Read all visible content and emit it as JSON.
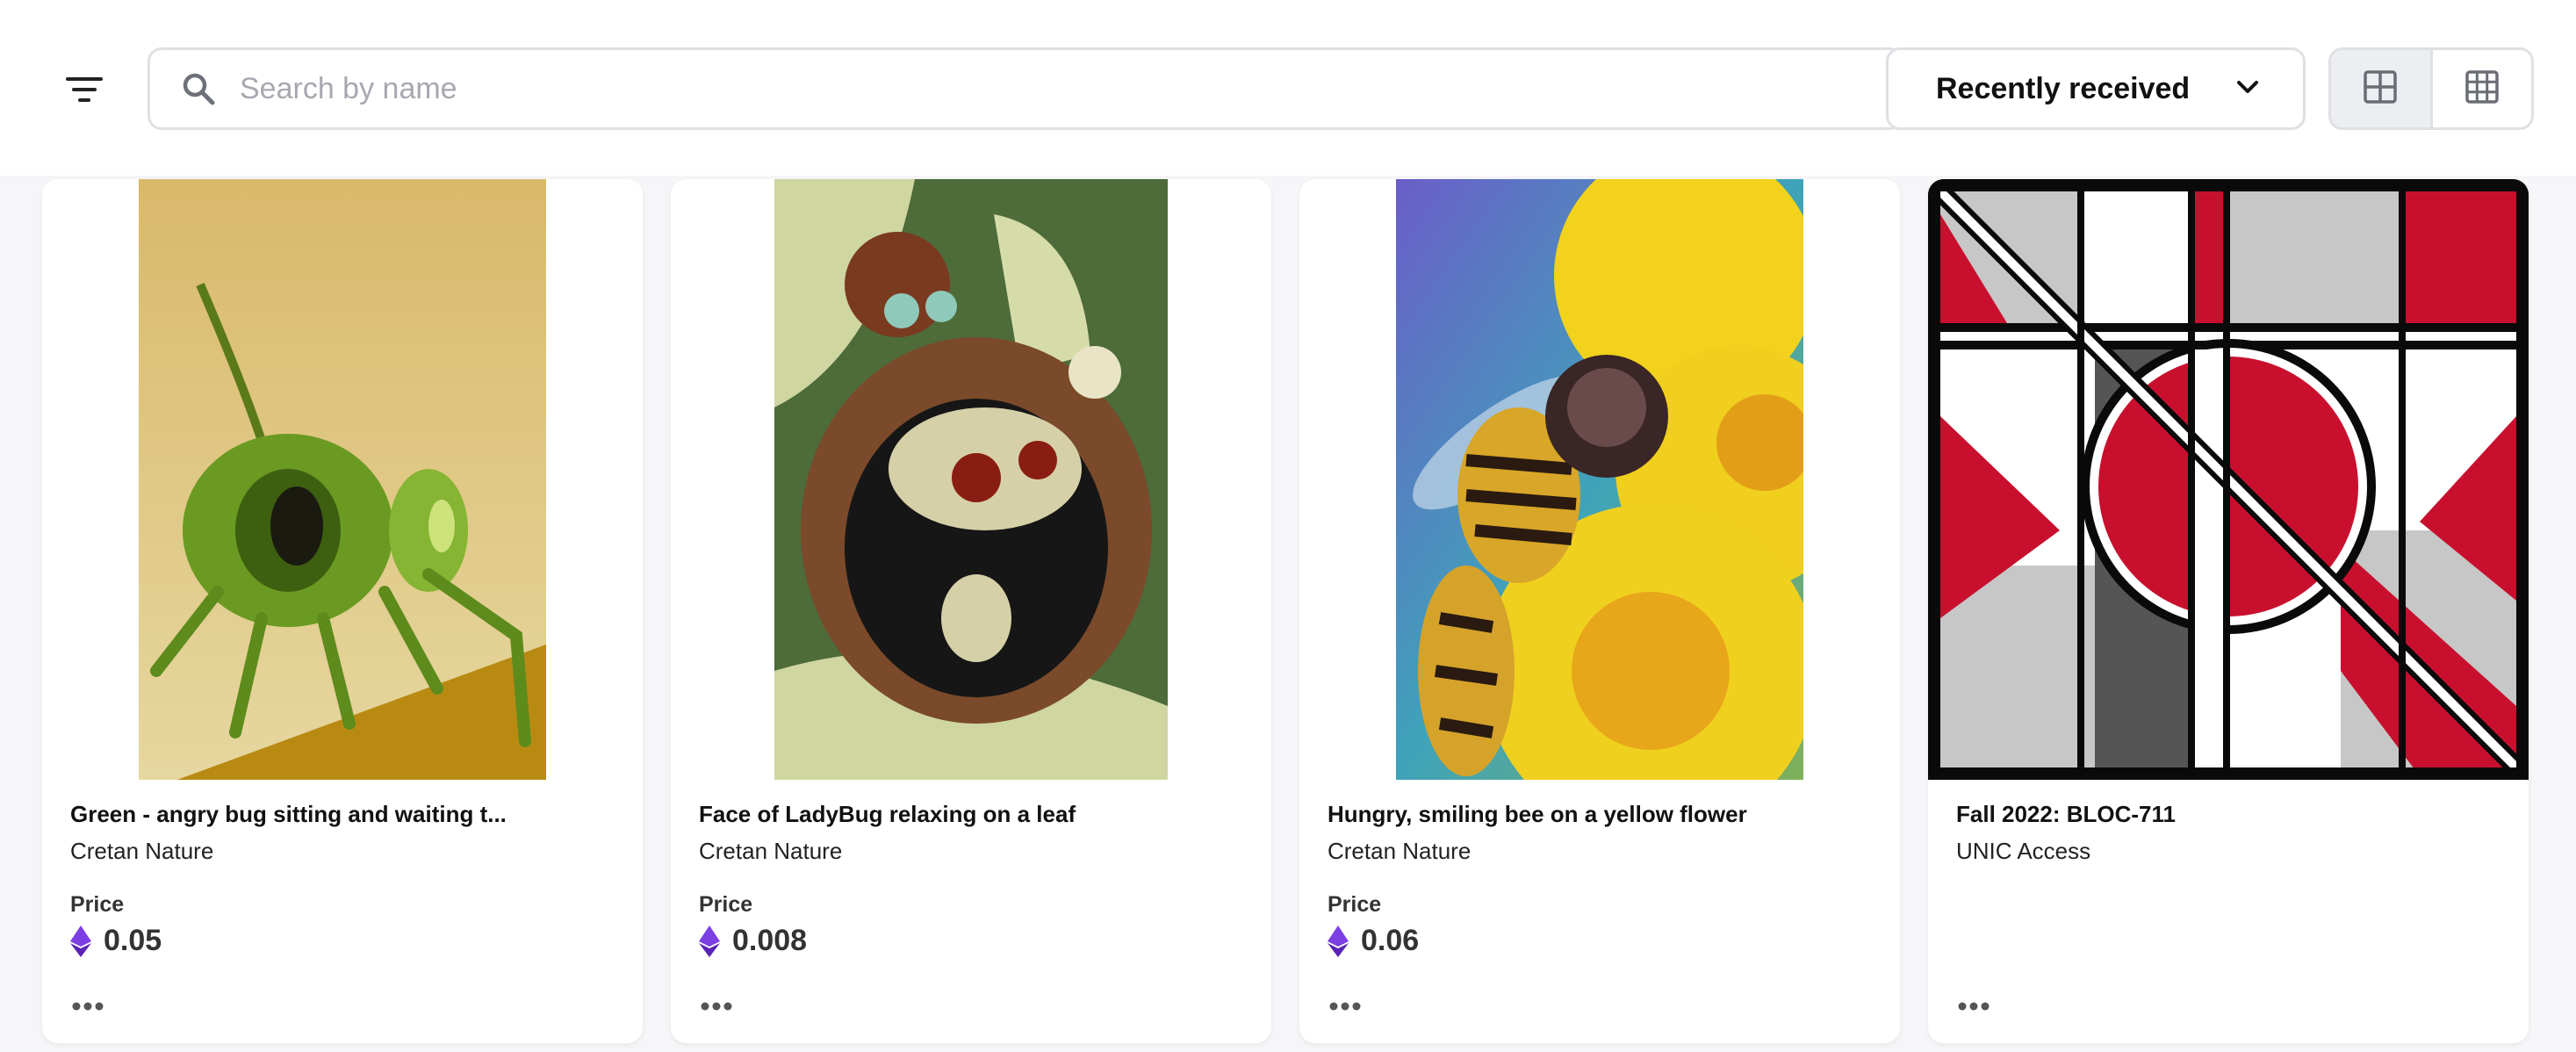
{
  "toolbar": {
    "filter_icon": "filter-lines-icon",
    "search": {
      "placeholder": "Search by name",
      "value": "",
      "icon": "search-icon"
    },
    "sort": {
      "selected": "Recently received",
      "icon": "chevron-down-icon"
    },
    "view_toggle": {
      "options": [
        "large-grid-icon",
        "small-grid-icon"
      ],
      "active": "large-grid-icon"
    }
  },
  "cards": [
    {
      "title": "Green - angry bug sitting and waiting t...",
      "collection": "Cretan Nature",
      "price_label": "Price",
      "price": "0.05",
      "currency_icon": "ethereum-icon",
      "more": "more-options-icon",
      "image": "green-bug-artwork"
    },
    {
      "title": "Face of LadyBug relaxing on a leaf",
      "collection": "Cretan Nature",
      "price_label": "Price",
      "price": "0.008",
      "currency_icon": "ethereum-icon",
      "more": "more-options-icon",
      "image": "ladybug-artwork"
    },
    {
      "title": "Hungry, smiling bee on a yellow flower",
      "collection": "Cretan Nature",
      "price_label": "Price",
      "price": "0.06",
      "currency_icon": "ethereum-icon",
      "more": "more-options-icon",
      "image": "bee-flower-artwork"
    },
    {
      "title": "Fall 2022: BLOC-711",
      "collection": "UNIC Access",
      "more": "more-options-icon",
      "image": "geometric-pass-artwork"
    }
  ],
  "colors": {
    "accent_eth": "#7b3fe4",
    "border": "#dfe0e4",
    "page_bg": "#f6f6f8",
    "placeholder": "#a7a8b0",
    "pass_red": "#c8102e",
    "pass_grey": "#c7c7c7",
    "pass_dark": "#555555"
  }
}
